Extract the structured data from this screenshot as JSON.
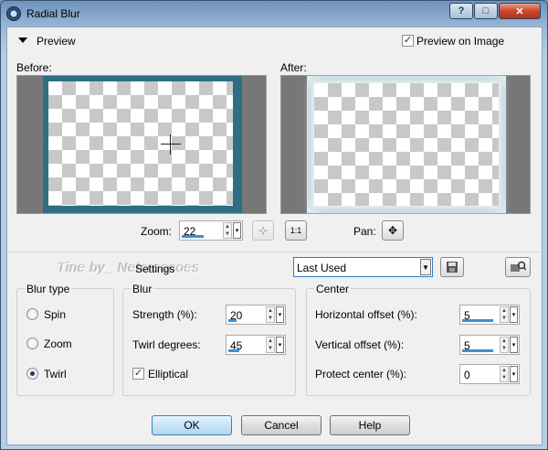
{
  "window": {
    "title": "Radial Blur"
  },
  "titlebar": {
    "help_glyph": "?",
    "maximize_glyph": "□",
    "close_glyph": "✕"
  },
  "preview": {
    "toggle_label": "Preview",
    "preview_on_image_label": "Preview on Image",
    "preview_on_image_checked": true,
    "before_label": "Before:",
    "after_label": "After:"
  },
  "zoom": {
    "label": "Zoom:",
    "value": "22",
    "pan_label": "Pan:",
    "fit_glyph": "⊹",
    "one_to_one_glyph": "1:1",
    "pan_glyph": "✥"
  },
  "watermark": {
    "text": "Tine by_ Netcreacoes"
  },
  "settings": {
    "label": "Settings",
    "preset_value": "Last Used",
    "save_icon": "save-icon",
    "manage_icon": "manage-presets-icon"
  },
  "blur_type": {
    "title": "Blur type",
    "options": [
      "Spin",
      "Zoom",
      "Twirl"
    ],
    "selected": "Twirl"
  },
  "blur": {
    "title": "Blur",
    "strength_label": "Strength (%):",
    "strength_value": "20",
    "strength_fraction": 0.2,
    "twirl_label": "Twirl degrees:",
    "twirl_value": "45",
    "twirl_fraction": 0.25,
    "elliptical_label": "Elliptical",
    "elliptical_checked": true
  },
  "center": {
    "title": "Center",
    "h_offset_label": "Horizontal offset (%):",
    "h_offset_value": "5",
    "v_offset_label": "Vertical offset (%):",
    "v_offset_value": "5",
    "protect_label": "Protect center (%):",
    "protect_value": "0"
  },
  "buttons": {
    "ok": "OK",
    "cancel": "Cancel",
    "help": "Help"
  }
}
